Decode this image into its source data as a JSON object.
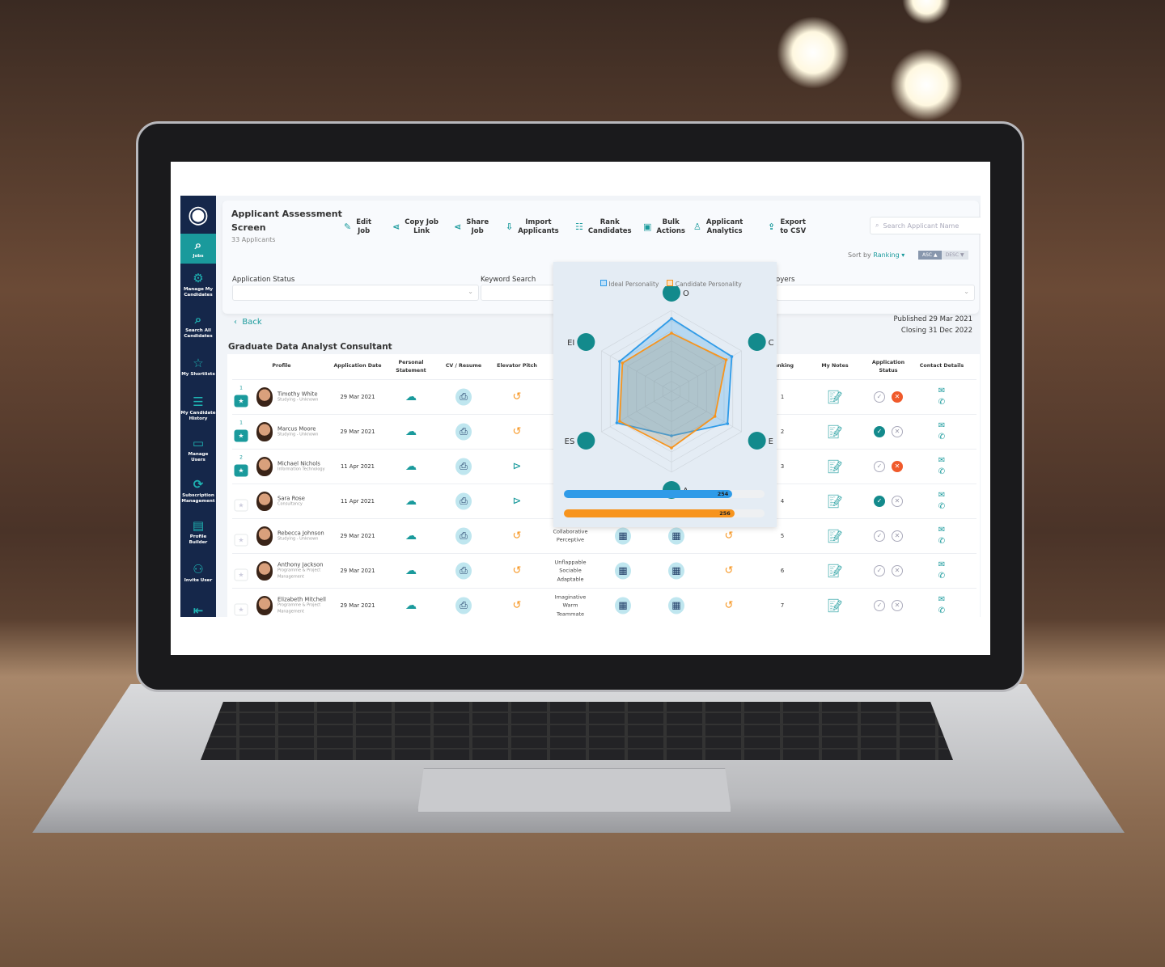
{
  "header": {
    "title_line1": "Applicant Assessment",
    "title_line2": "Screen",
    "count": "33 Applicants"
  },
  "toolbar": [
    {
      "icon": "pencil-icon",
      "l1": "Edit",
      "l2": "Job",
      "x": 202
    },
    {
      "icon": "link-share-icon",
      "l1": "Copy Job",
      "l2": "Link",
      "x": 262
    },
    {
      "icon": "share-icon",
      "l1": "Share",
      "l2": "Job",
      "x": 338
    },
    {
      "icon": "import-icon",
      "l1": "Import",
      "l2": "Applicants",
      "x": 402
    },
    {
      "icon": "list-icon",
      "l1": "Rank",
      "l2": "Candidates",
      "x": 488
    },
    {
      "icon": "bulk-icon",
      "l1": "Bulk",
      "l2": "Actions",
      "x": 572
    },
    {
      "icon": "user-icon",
      "l1": "Applicant",
      "l2": "Analytics",
      "x": 634
    },
    {
      "icon": "export-icon",
      "l1": "Export",
      "l2": "to CSV",
      "x": 726
    }
  ],
  "search": {
    "placeholder": "Search Applicant Name"
  },
  "sort": {
    "prefix": "Sort by",
    "value": "Ranking",
    "asc": "ASC",
    "desc": "DESC"
  },
  "filters": {
    "status_label": "Application Status",
    "keyword_label": "Keyword Search",
    "employers_label_partial": "oyers"
  },
  "back": "Back",
  "job": {
    "title": "Graduate Data Analyst Consultant",
    "published": "Published 29 Mar 2021",
    "closing": "Closing 31 Dec 2022"
  },
  "sidebar": [
    {
      "icon": "jobs-search-icon",
      "label": "Jobs",
      "active": true
    },
    {
      "icon": "manage-candidates-icon",
      "label": "Manage My Candidates"
    },
    {
      "icon": "search-icon",
      "label": "Search All Candidates"
    },
    {
      "icon": "star-icon",
      "label": "My Shortlists"
    },
    {
      "icon": "history-list-icon",
      "label": "My Candidate History"
    },
    {
      "icon": "briefcase-icon",
      "label": "Manage Users"
    },
    {
      "icon": "subscription-icon",
      "label": "Subscription Management"
    },
    {
      "icon": "profile-builder-icon",
      "label": "Profile Builder"
    },
    {
      "icon": "invite-user-icon",
      "label": "Invite User"
    },
    {
      "icon": "logout-icon",
      "label": "Logout"
    }
  ],
  "columns": {
    "profile": "Profile",
    "date": "Application Date",
    "statement": "Personal Statement",
    "cv": "CV / Resume",
    "pitch": "Elevator Pitch",
    "ranking_partial": "anking",
    "notes": "My Notes",
    "status": "Application Status",
    "contact": "Contact Details"
  },
  "rows": [
    {
      "rank": "1",
      "starred": true,
      "name": "Timothy White",
      "sub": "Studying - Unknown",
      "date": "29 Mar 2021",
      "pitch": "replay",
      "traits": [],
      "ranking": "1",
      "status": "rejected"
    },
    {
      "rank": "1",
      "starred": true,
      "name": "Marcus Moore",
      "sub": "Studying - Unknown",
      "date": "29 Mar 2021",
      "pitch": "replay",
      "traits": [],
      "ranking": "2",
      "status": "accepted"
    },
    {
      "rank": "2",
      "starred": true,
      "name": "Michael Nichols",
      "sub": "Information Technology",
      "date": "11 Apr 2021",
      "pitch": "play",
      "traits": [],
      "ranking": "3",
      "status": "rejected"
    },
    {
      "rank": "",
      "starred": false,
      "name": "Sara Rose",
      "sub": "Consultancy",
      "date": "11 Apr 2021",
      "pitch": "play",
      "traits": [],
      "ranking": "4",
      "status": "accepted"
    },
    {
      "rank": "",
      "starred": false,
      "name": "Rebecca Johnson",
      "sub": "Studying - Unknown",
      "date": "29 Mar 2021",
      "pitch": "replay",
      "traits": [
        "Collaborative",
        "Perceptive"
      ],
      "ranking": "5",
      "status": "none"
    },
    {
      "rank": "",
      "starred": false,
      "name": "Anthony Jackson",
      "sub": "Programme & Project Management",
      "date": "29 Mar 2021",
      "pitch": "replay",
      "traits": [
        "Unflappable",
        "Sociable",
        "Adaptable"
      ],
      "ranking": "6",
      "status": "none"
    },
    {
      "rank": "",
      "starred": false,
      "name": "Elizabeth Mitchell",
      "sub": "Programme & Project Management",
      "date": "29 Mar 2021",
      "pitch": "replay",
      "traits": [
        "Imaginative",
        "Warm",
        "Teammate"
      ],
      "ranking": "7",
      "status": "none"
    }
  ],
  "chart_data": {
    "type": "radar",
    "legend": [
      "Ideal Personality",
      "Candidate Personality"
    ],
    "axes": [
      "O",
      "C",
      "E",
      "A",
      "ES",
      "EI"
    ],
    "range": [
      0,
      100
    ],
    "series": [
      {
        "name": "Ideal Personality",
        "color": "#2f9be8",
        "values": [
          90,
          86,
          80,
          55,
          78,
          74
        ]
      },
      {
        "name": "Candidate Personality",
        "color": "#f7941d",
        "values": [
          72,
          78,
          62,
          70,
          74,
          70
        ]
      }
    ],
    "bars": [
      {
        "value": 254,
        "color": "#2f9be8",
        "fraction": 0.84
      },
      {
        "value": 256,
        "color": "#f7941d",
        "fraction": 0.85
      }
    ]
  },
  "colors": {
    "teal": "#1a9a9c",
    "navy": "#15274a",
    "reject": "#f05a2b",
    "orange": "#f7941d",
    "blue": "#2f9be8"
  }
}
